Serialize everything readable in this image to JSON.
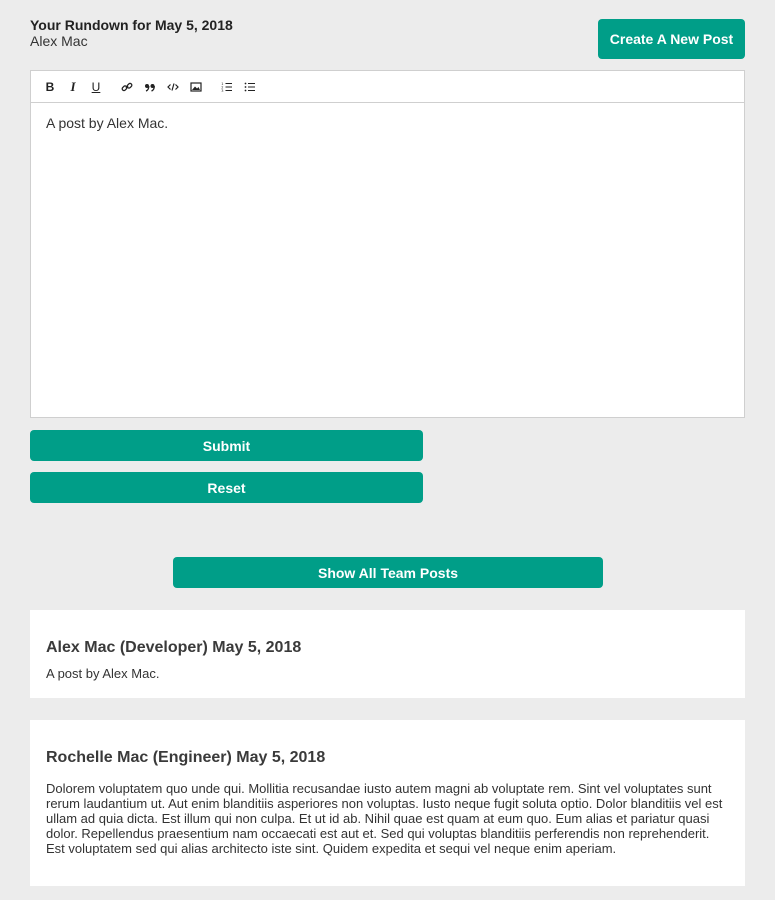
{
  "header": {
    "title": "Your Rundown for May 5, 2018",
    "user": "Alex Mac",
    "create_button": "Create A New Post"
  },
  "editor": {
    "toolbar": [
      {
        "name": "bold-button",
        "label": "B"
      },
      {
        "name": "italic-button",
        "label": "I"
      },
      {
        "name": "underline-button",
        "label": "U"
      },
      {
        "name": "link-button",
        "icon": "link-icon"
      },
      {
        "name": "quote-button",
        "icon": "quote-icon"
      },
      {
        "name": "code-button",
        "icon": "code-icon"
      },
      {
        "name": "image-button",
        "icon": "image-icon"
      },
      {
        "name": "ordered-list-button",
        "icon": "ordered-list-icon"
      },
      {
        "name": "bullet-list-button",
        "icon": "bullet-list-icon"
      }
    ],
    "content": "A post by Alex Mac."
  },
  "actions": {
    "submit": "Submit",
    "reset": "Reset",
    "show_all": "Show All Team Posts"
  },
  "posts": [
    {
      "title": "Alex Mac (Developer) May 5, 2018",
      "body": "A post by Alex Mac."
    },
    {
      "title": "Rochelle Mac (Engineer) May 5, 2018",
      "body": "Dolorem voluptatem quo unde qui. Mollitia recusandae iusto autem magni ab voluptate rem. Sint vel voluptates sunt rerum laudantium ut. Aut enim blanditiis asperiores non voluptas. Iusto neque fugit soluta optio. Dolor blanditiis vel est ullam ad quia dicta. Est illum qui non culpa. Et ut id ab. Nihil quae est quam at eum quo. Eum alias et pariatur quasi dolor. Repellendus praesentium nam occaecati est aut et. Sed qui voluptas blanditiis perferendis non reprehenderit. Est voluptatem sed qui alias architecto iste sint. Quidem expedita et sequi vel neque enim aperiam."
    }
  ],
  "colors": {
    "accent": "#009e88",
    "background": "#ececec"
  }
}
